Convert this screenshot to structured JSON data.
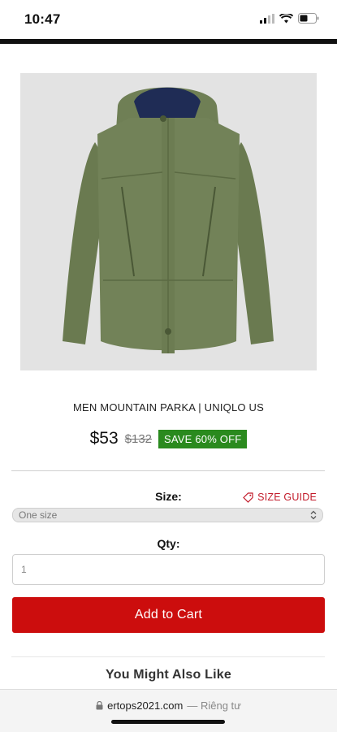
{
  "status_bar": {
    "time": "10:47"
  },
  "product": {
    "title": "MEN MOUNTAIN PARKA | UNIQLO US",
    "image_alt": "green hooded parka",
    "price": "$53",
    "original_price": "$132",
    "save_badge": "SAVE 60% OFF",
    "badge_color": "#2a8a1e",
    "jacket_color": "#6f7f55"
  },
  "size": {
    "label": "Size:",
    "guide_label": "SIZE GUIDE",
    "selected": "One size"
  },
  "qty": {
    "label": "Qty:",
    "value": "1"
  },
  "actions": {
    "add_to_cart": "Add to Cart",
    "accent": "#cc0d0d"
  },
  "recommendations": {
    "title": "You Might Also Like"
  },
  "browser": {
    "domain": "ertops2021.com",
    "suffix": "— Riêng tư"
  }
}
